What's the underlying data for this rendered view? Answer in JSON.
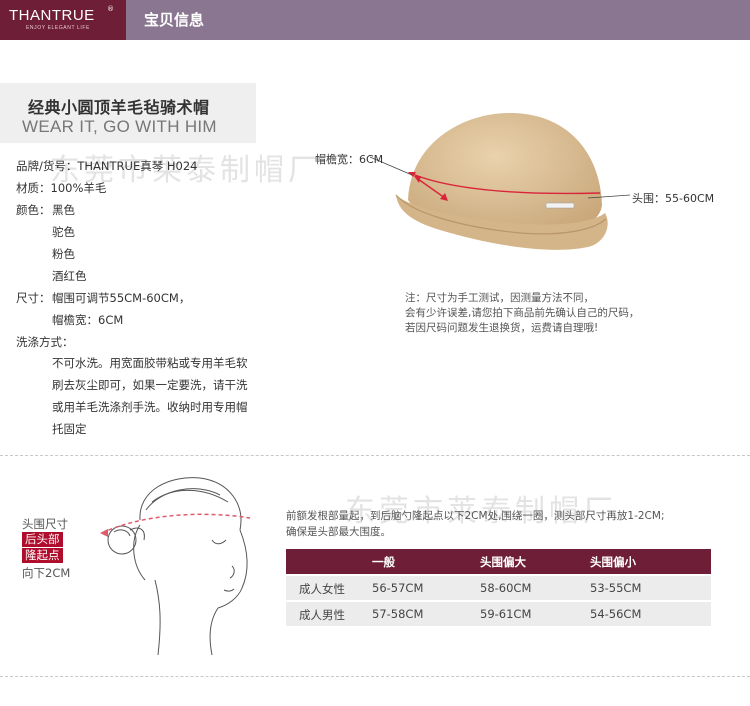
{
  "header": {
    "logo_text": "THANTRUE",
    "logo_reg": "®",
    "logo_tagline": "ENJOY ELEGANT LIFE",
    "section_title": "宝贝信息"
  },
  "product": {
    "title_cn": "经典小圆顶羊毛毡骑术帽",
    "title_en": "WEAR IT, GO WITH HIM"
  },
  "specs": {
    "brand": "品牌/货号：THANTRUE真琴 H024",
    "material": "材质：100%羊毛",
    "color_label": "颜色：",
    "colors": [
      "黑色",
      "驼色",
      "粉色",
      "酒红色"
    ],
    "size_label": "尺寸：",
    "size_line1": "帽围可调节55CM-60CM，",
    "size_line2": "帽檐宽：6CM",
    "wash_label": "洗涤方式：",
    "wash_lines": [
      "不可水洗。用宽面胶带粘或专用羊毛软",
      "刷去灰尘即可，如果一定要洗，请干洗",
      "或用羊毛洗涤剂手洗。收纳时用专用帽",
      "托固定"
    ]
  },
  "hat_labels": {
    "brim": "帽檐宽：6CM",
    "head": "头围：55-60CM"
  },
  "measure_note": [
    "注：尺寸为手工测试，因测量方法不同，",
    "会有少许误差,请您拍下商品前先确认自己的尺码，",
    "若因尺码问题发生退换货，运费请自理哦!"
  ],
  "watermark": "东莞市莱泰制帽厂",
  "head_labels": {
    "line1": "头围尺寸",
    "line2": "后头部",
    "line3": "隆起点",
    "line4": "向下2CM"
  },
  "size_note": [
    "前额发根部量起，到后脑勺隆起点以下2CM处,围绕一圈，测头部尺寸再放1-2CM;",
    "确保是头部最大围度。"
  ],
  "size_table": {
    "headers": [
      "",
      "一般",
      "头围偏大",
      "头围偏小"
    ],
    "rows": [
      [
        "成人女性",
        "56-57CM",
        "58-60CM",
        "53-55CM"
      ],
      [
        "成人男性",
        "57-58CM",
        "59-61CM",
        "54-56CM"
      ]
    ]
  },
  "colors": {
    "brand_dark": "#6e1e36",
    "header_purple": "#8a7690",
    "accent_red": "#b00d2c",
    "hat_camel": "#dcbf93"
  }
}
